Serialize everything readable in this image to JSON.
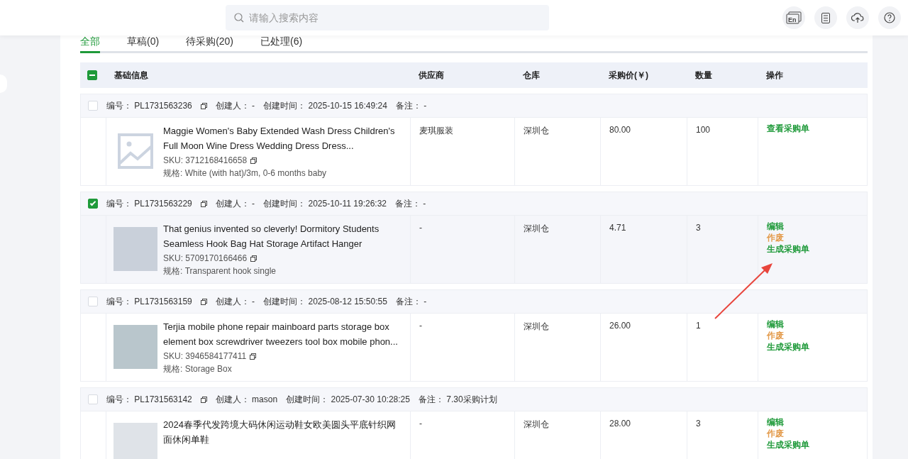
{
  "search": {
    "placeholder": "请输入搜索内容"
  },
  "toolbar_icons": [
    {
      "kind": "language",
      "label": "En"
    },
    {
      "kind": "document"
    },
    {
      "kind": "cloud"
    },
    {
      "kind": "help"
    }
  ],
  "tabs": [
    {
      "label": "全部",
      "selected": true
    },
    {
      "label": "草稿(0)",
      "selected": false
    },
    {
      "label": "待采购(20)",
      "selected": false
    },
    {
      "label": "已处理(6)",
      "selected": false
    }
  ],
  "select_all": {
    "indeterminate": true
  },
  "columns": [
    "基础信息",
    "供应商",
    "仓库",
    "采购价(￥)",
    "数量",
    "操作"
  ],
  "orders": [
    {
      "checked": false,
      "fields": [
        {
          "label": "编号：",
          "value": "PL1731563236",
          "copy": true
        },
        {
          "label": "创建人：",
          "value": "-"
        },
        {
          "label": "创建时间：",
          "value": "2025-10-15 16:49:24"
        },
        {
          "label": "备注：",
          "value": "-"
        }
      ],
      "item": {
        "kind": "placeholder",
        "title": "Maggie Women's Baby Extended Wash Dress Children's Full Moon Wine Dress Wedding Dress Dress...",
        "sku": "SKU: 3712168416658",
        "spec": "规格: White (with hat)/3m, 0-6 months baby",
        "supplier": "麦琪服装",
        "warehouse": "深圳仓",
        "price": "80.00",
        "qty": "100"
      },
      "actions": [
        {
          "label": "查看采购单",
          "kind": "primary"
        }
      ]
    },
    {
      "checked": true,
      "fields": [
        {
          "label": "编号：",
          "value": "PL1731563229",
          "copy": true
        },
        {
          "label": "创建人：",
          "value": "-"
        },
        {
          "label": "创建时间：",
          "value": "2025-10-11 19:26:32"
        },
        {
          "label": "备注：",
          "value": "-"
        }
      ],
      "item": {
        "kind": "photo",
        "title": "That genius invented so cleverly! Dormitory Students Seamless Hook Bag Hat Storage Artifact Hanger",
        "sku": "SKU: 5709170166466",
        "spec": "规格: Transparent hook single",
        "supplier": "-",
        "warehouse": "深圳仓",
        "price": "4.71",
        "qty": "3"
      },
      "actions": [
        {
          "label": "编辑",
          "kind": "primary"
        },
        {
          "label": "作废",
          "kind": "warning"
        },
        {
          "label": "生成采购单",
          "kind": "primary"
        }
      ]
    },
    {
      "checked": false,
      "fields": [
        {
          "label": "编号：",
          "value": "PL1731563159",
          "copy": true
        },
        {
          "label": "创建人：",
          "value": "-"
        },
        {
          "label": "创建时间：",
          "value": "2025-08-12 15:50:55"
        },
        {
          "label": "备注：",
          "value": "-"
        }
      ],
      "item": {
        "kind": "photo",
        "title": "Terjia mobile phone repair mainboard parts storage box element box screwdriver tweezers tool box mobile phon...",
        "sku": "SKU: 3946584177411",
        "spec": "规格: Storage Box",
        "supplier": "-",
        "warehouse": "深圳仓",
        "price": "26.00",
        "qty": "1"
      },
      "actions": [
        {
          "label": "编辑",
          "kind": "primary"
        },
        {
          "label": "作废",
          "kind": "warning"
        },
        {
          "label": "生成采购单",
          "kind": "primary"
        }
      ]
    },
    {
      "checked": false,
      "fields": [
        {
          "label": "编号：",
          "value": "PL1731563142",
          "copy": true
        },
        {
          "label": "创建人：",
          "value": "mason"
        },
        {
          "label": "创建时间：",
          "value": "2025-07-30 10:28:25"
        },
        {
          "label": "备注：",
          "value": "7.30采购计划"
        }
      ],
      "item": {
        "kind": "photo",
        "title": "2024春季代发跨境大码休闲运动鞋女欧美圆头平底针织网面休闲单鞋",
        "supplier": "-",
        "warehouse": "深圳仓",
        "price": "28.00",
        "qty": "3"
      },
      "actions": [
        {
          "label": "编辑",
          "kind": "primary"
        },
        {
          "label": "作废",
          "kind": "warning"
        },
        {
          "label": "生成采购单",
          "kind": "primary"
        }
      ]
    }
  ]
}
